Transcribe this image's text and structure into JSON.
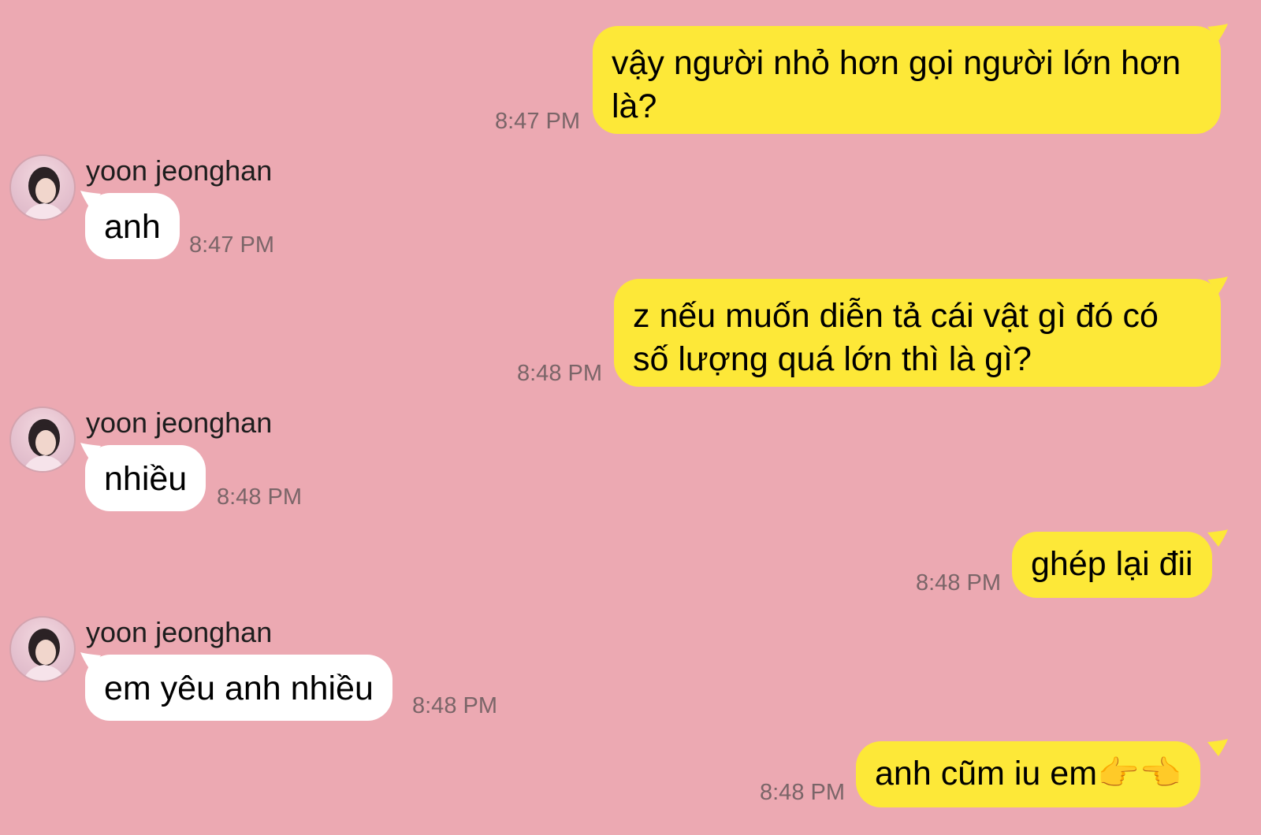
{
  "contact": {
    "name": "yoon jeonghan"
  },
  "messages": [
    {
      "from": "me",
      "lines": [
        "vậy người nhỏ hơn gọi người lớn hơn",
        "là?"
      ],
      "time": "8:47 PM"
    },
    {
      "from": "them",
      "lines": [
        "anh"
      ],
      "time": "8:47 PM"
    },
    {
      "from": "me",
      "lines": [
        "z nếu muốn diễn tả cái vật gì đó có",
        "số lượng quá lớn thì là gì?"
      ],
      "time": "8:48 PM"
    },
    {
      "from": "them",
      "lines": [
        "nhiều"
      ],
      "time": "8:48 PM"
    },
    {
      "from": "me",
      "lines": [
        "ghép lại đii"
      ],
      "time": "8:48 PM"
    },
    {
      "from": "them",
      "lines": [
        "em yêu anh nhiều"
      ],
      "time": "8:48 PM"
    },
    {
      "from": "me",
      "lines": [
        "anh cũm iu em👉👈"
      ],
      "time": "8:48 PM"
    }
  ],
  "colors": {
    "background": "#eca9b2",
    "my_bubble": "#fde838",
    "their_bubble": "#ffffff",
    "timestamp": "#7a6568"
  }
}
